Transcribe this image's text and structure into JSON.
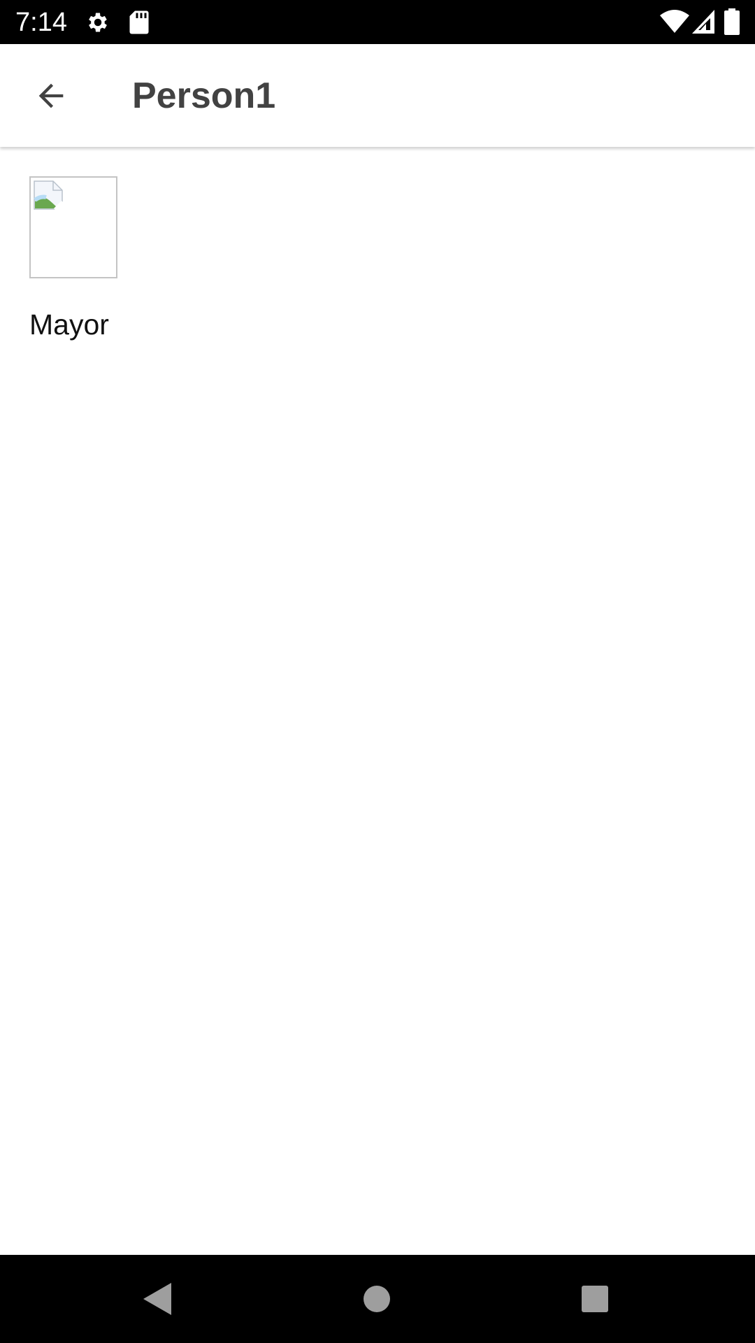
{
  "status_bar": {
    "time": "7:14",
    "icons": [
      "settings-icon",
      "sd-card-icon",
      "wifi-icon",
      "cell-signal-icon",
      "battery-icon"
    ]
  },
  "app_bar": {
    "title": "Person1",
    "back_icon": "arrow-back-icon"
  },
  "content": {
    "items": [
      {
        "label": "Mayor",
        "image": "broken-image-icon"
      }
    ]
  },
  "nav_bar": {
    "buttons": [
      "back-triangle-icon",
      "home-circle-icon",
      "recents-square-icon"
    ]
  },
  "colors": {
    "status_bar_bg": "#000000",
    "app_bar_bg": "#ffffff",
    "title_text": "#424242",
    "nav_bar_bg": "#000000",
    "nav_icon": "#9e9e9e"
  }
}
